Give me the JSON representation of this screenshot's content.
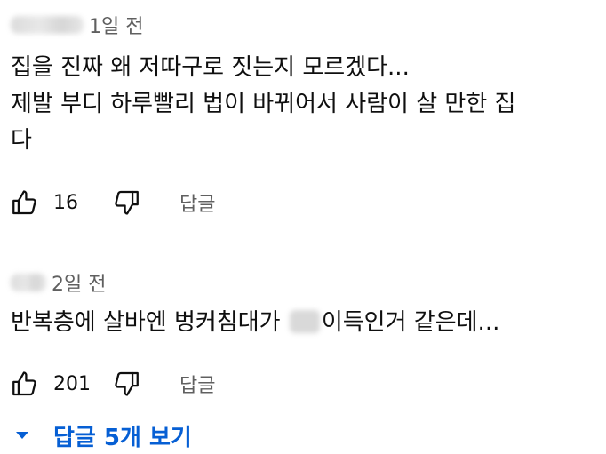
{
  "comments": [
    {
      "timestamp": "1일 전",
      "text_lines": [
        "집을 진짜 왜 저따구로 짓는지 모르겠다...",
        "제발 부디 하루빨리 법이 바뀌어서 사람이 살 만한 집",
        "다"
      ],
      "like_count": "16",
      "reply_label": "답글"
    },
    {
      "timestamp": "2일 전",
      "text_before_blur": "반복층에 살바엔 벙커침대가 ",
      "text_after_blur": "이득인거 같은데...",
      "like_count": "201",
      "reply_label": "답글"
    }
  ],
  "replies_toggle": {
    "label": "답글 5개 보기",
    "color": "#065fd4"
  },
  "icons": {
    "like": "thumbs-up-icon",
    "dislike": "thumbs-down-icon",
    "expand": "caret-down-icon"
  }
}
